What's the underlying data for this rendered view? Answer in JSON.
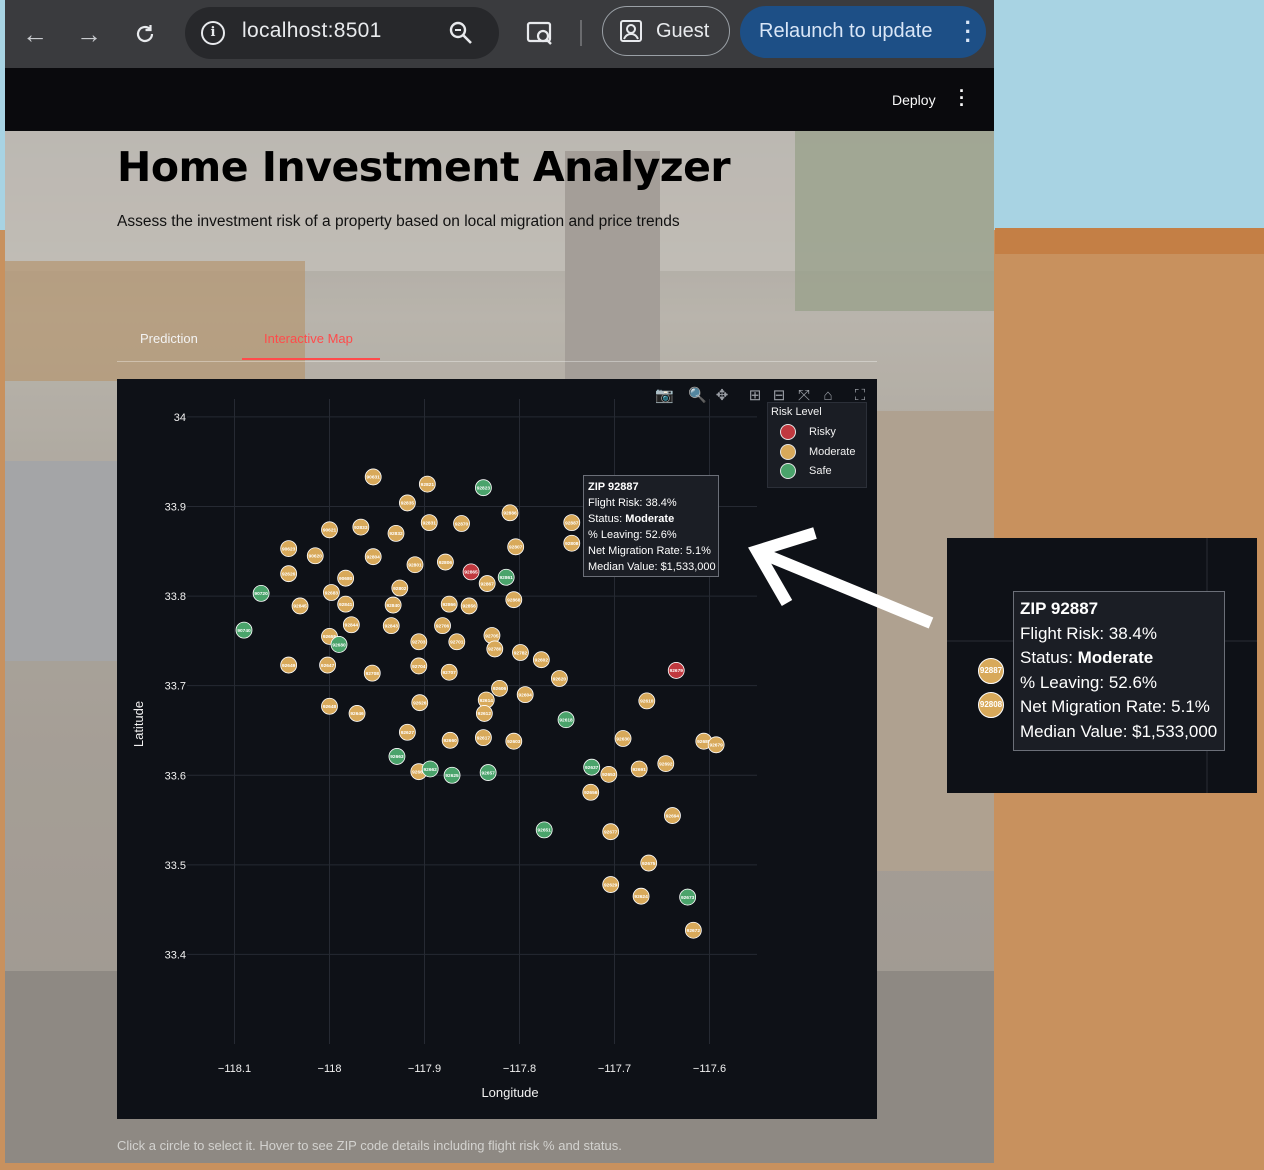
{
  "browser": {
    "url": "localhost:8501",
    "profile_label": "Guest",
    "relaunch_label": "Relaunch to update"
  },
  "header": {
    "deploy_label": "Deploy"
  },
  "page": {
    "title": "Home Investment Analyzer",
    "subtitle": "Assess the investment risk of a property based on local migration and price trends",
    "tabs": [
      {
        "label": "Prediction",
        "active": false
      },
      {
        "label": "Interactive Map",
        "active": true
      }
    ],
    "caption": "Click a circle to select it. Hover to see ZIP code details including flight risk % and status."
  },
  "colors": {
    "risky": "#c0393f",
    "moderate": "#d8a95a",
    "safe": "#4aa36b",
    "accent": "#ff4b4b",
    "plot_bg": "#0e1117"
  },
  "chart_data": {
    "type": "scatter",
    "xlabel": "Longitude",
    "ylabel": "Latitude",
    "xlim": [
      -118.15,
      -117.55
    ],
    "ylim": [
      33.3,
      34.02
    ],
    "xticks": [
      -118.1,
      -118,
      -117.9,
      -117.8,
      -117.7,
      -117.6
    ],
    "xtick_labels": [
      "−118.1",
      "−118",
      "−117.9",
      "−117.8",
      "−117.7",
      "−117.6"
    ],
    "yticks": [
      33.4,
      33.5,
      33.6,
      33.7,
      33.8,
      33.9,
      34
    ],
    "ytick_labels": [
      "33.4",
      "33.5",
      "33.6",
      "33.7",
      "33.8",
      "33.9",
      "34"
    ],
    "grid": true,
    "legend": {
      "title": "Risk Level",
      "placement": "top-right",
      "items": [
        "Risky",
        "Moderate",
        "Safe"
      ]
    },
    "points": [
      {
        "zip": "90631",
        "x": -117.954,
        "y": 33.933,
        "risk": "Moderate"
      },
      {
        "zip": "92821",
        "x": -117.897,
        "y": 33.925,
        "risk": "Moderate"
      },
      {
        "zip": "92823",
        "x": -117.838,
        "y": 33.921,
        "risk": "Safe"
      },
      {
        "zip": "92835",
        "x": -117.918,
        "y": 33.904,
        "risk": "Moderate"
      },
      {
        "zip": "92886",
        "x": -117.81,
        "y": 33.893,
        "risk": "Moderate"
      },
      {
        "zip": "92887",
        "x": -117.745,
        "y": 33.882,
        "risk": "Moderate"
      },
      {
        "zip": "92831",
        "x": -117.895,
        "y": 33.882,
        "risk": "Moderate"
      },
      {
        "zip": "92870",
        "x": -117.861,
        "y": 33.881,
        "risk": "Moderate"
      },
      {
        "zip": "90621",
        "x": -118.0,
        "y": 33.874,
        "risk": "Moderate"
      },
      {
        "zip": "92833",
        "x": -117.967,
        "y": 33.877,
        "risk": "Moderate"
      },
      {
        "zip": "92832",
        "x": -117.93,
        "y": 33.87,
        "risk": "Moderate"
      },
      {
        "zip": "92808",
        "x": -117.745,
        "y": 33.859,
        "risk": "Moderate"
      },
      {
        "zip": "92807",
        "x": -117.804,
        "y": 33.855,
        "risk": "Moderate"
      },
      {
        "zip": "90623",
        "x": -118.043,
        "y": 33.853,
        "risk": "Moderate"
      },
      {
        "zip": "90620",
        "x": -118.015,
        "y": 33.845,
        "risk": "Moderate"
      },
      {
        "zip": "92804",
        "x": -117.954,
        "y": 33.844,
        "risk": "Moderate"
      },
      {
        "zip": "92806",
        "x": -117.878,
        "y": 33.838,
        "risk": "Moderate"
      },
      {
        "zip": "92801",
        "x": -117.91,
        "y": 33.835,
        "risk": "Moderate"
      },
      {
        "zip": "92865",
        "x": -117.851,
        "y": 33.827,
        "risk": "Risky"
      },
      {
        "zip": "92626",
        "x": -118.043,
        "y": 33.825,
        "risk": "Moderate"
      },
      {
        "zip": "90680",
        "x": -117.983,
        "y": 33.82,
        "risk": "Moderate"
      },
      {
        "zip": "92861",
        "x": -117.814,
        "y": 33.821,
        "risk": "Safe"
      },
      {
        "zip": "92867",
        "x": -117.834,
        "y": 33.814,
        "risk": "Moderate"
      },
      {
        "zip": "92802",
        "x": -117.926,
        "y": 33.809,
        "risk": "Moderate"
      },
      {
        "zip": "90720",
        "x": -118.072,
        "y": 33.803,
        "risk": "Safe"
      },
      {
        "zip": "92683",
        "x": -117.998,
        "y": 33.804,
        "risk": "Moderate"
      },
      {
        "zip": "92868",
        "x": -117.806,
        "y": 33.796,
        "risk": "Moderate"
      },
      {
        "zip": "92845",
        "x": -118.031,
        "y": 33.789,
        "risk": "Moderate"
      },
      {
        "zip": "92841",
        "x": -117.983,
        "y": 33.791,
        "risk": "Moderate"
      },
      {
        "zip": "92840",
        "x": -117.933,
        "y": 33.79,
        "risk": "Moderate"
      },
      {
        "zip": "92866",
        "x": -117.874,
        "y": 33.791,
        "risk": "Moderate"
      },
      {
        "zip": "92856",
        "x": -117.853,
        "y": 33.789,
        "risk": "Moderate"
      },
      {
        "zip": "90740",
        "x": -118.09,
        "y": 33.762,
        "risk": "Safe"
      },
      {
        "zip": "92844",
        "x": -117.977,
        "y": 33.768,
        "risk": "Moderate"
      },
      {
        "zip": "92843",
        "x": -117.935,
        "y": 33.767,
        "risk": "Moderate"
      },
      {
        "zip": "92706",
        "x": -117.881,
        "y": 33.767,
        "risk": "Moderate"
      },
      {
        "zip": "92655",
        "x": -118.0,
        "y": 33.755,
        "risk": "Moderate"
      },
      {
        "zip": "92705",
        "x": -117.829,
        "y": 33.756,
        "risk": "Moderate"
      },
      {
        "zip": "92703",
        "x": -117.906,
        "y": 33.749,
        "risk": "Moderate"
      },
      {
        "zip": "92701",
        "x": -117.866,
        "y": 33.749,
        "risk": "Moderate"
      },
      {
        "zip": "92680",
        "x": -117.99,
        "y": 33.746,
        "risk": "Safe"
      },
      {
        "zip": "92780",
        "x": -117.826,
        "y": 33.741,
        "risk": "Moderate"
      },
      {
        "zip": "92782",
        "x": -117.799,
        "y": 33.737,
        "risk": "Moderate"
      },
      {
        "zip": "92602",
        "x": -117.777,
        "y": 33.729,
        "risk": "Moderate"
      },
      {
        "zip": "92649",
        "x": -118.043,
        "y": 33.723,
        "risk": "Moderate"
      },
      {
        "zip": "92647",
        "x": -118.002,
        "y": 33.723,
        "risk": "Moderate"
      },
      {
        "zip": "92704",
        "x": -117.906,
        "y": 33.722,
        "risk": "Moderate"
      },
      {
        "zip": "92679",
        "x": -117.635,
        "y": 33.717,
        "risk": "Risky"
      },
      {
        "zip": "92708",
        "x": -117.955,
        "y": 33.714,
        "risk": "Moderate"
      },
      {
        "zip": "92707",
        "x": -117.874,
        "y": 33.715,
        "risk": "Moderate"
      },
      {
        "zip": "92620",
        "x": -117.758,
        "y": 33.708,
        "risk": "Moderate"
      },
      {
        "zip": "92606",
        "x": -117.821,
        "y": 33.697,
        "risk": "Moderate"
      },
      {
        "zip": "92604",
        "x": -117.794,
        "y": 33.69,
        "risk": "Moderate"
      },
      {
        "zip": "92614",
        "x": -117.835,
        "y": 33.684,
        "risk": "Moderate"
      },
      {
        "zip": "92610",
        "x": -117.666,
        "y": 33.683,
        "risk": "Moderate"
      },
      {
        "zip": "92626",
        "x": -117.905,
        "y": 33.681,
        "risk": "Moderate"
      },
      {
        "zip": "92648",
        "x": -118.0,
        "y": 33.677,
        "risk": "Moderate"
      },
      {
        "zip": "92646",
        "x": -117.971,
        "y": 33.669,
        "risk": "Moderate"
      },
      {
        "zip": "92612",
        "x": -117.837,
        "y": 33.669,
        "risk": "Moderate"
      },
      {
        "zip": "92618",
        "x": -117.751,
        "y": 33.662,
        "risk": "Safe"
      },
      {
        "zip": "92627",
        "x": -117.918,
        "y": 33.648,
        "risk": "Moderate"
      },
      {
        "zip": "92617",
        "x": -117.838,
        "y": 33.642,
        "risk": "Moderate"
      },
      {
        "zip": "92630",
        "x": -117.691,
        "y": 33.641,
        "risk": "Moderate"
      },
      {
        "zip": "92660",
        "x": -117.873,
        "y": 33.639,
        "risk": "Moderate"
      },
      {
        "zip": "92603",
        "x": -117.806,
        "y": 33.638,
        "risk": "Moderate"
      },
      {
        "zip": "92688",
        "x": -117.606,
        "y": 33.638,
        "risk": "Moderate"
      },
      {
        "zip": "92679",
        "x": -117.593,
        "y": 33.634,
        "risk": "Moderate"
      },
      {
        "zip": "92663",
        "x": -117.929,
        "y": 33.621,
        "risk": "Safe"
      },
      {
        "zip": "92637",
        "x": -117.724,
        "y": 33.609,
        "risk": "Safe"
      },
      {
        "zip": "92661",
        "x": -117.906,
        "y": 33.604,
        "risk": "Moderate"
      },
      {
        "zip": "92662",
        "x": -117.894,
        "y": 33.607,
        "risk": "Safe"
      },
      {
        "zip": "92625",
        "x": -117.871,
        "y": 33.6,
        "risk": "Safe"
      },
      {
        "zip": "92657",
        "x": -117.833,
        "y": 33.603,
        "risk": "Safe"
      },
      {
        "zip": "92653",
        "x": -117.706,
        "y": 33.601,
        "risk": "Moderate"
      },
      {
        "zip": "92691",
        "x": -117.674,
        "y": 33.607,
        "risk": "Moderate"
      },
      {
        "zip": "92692",
        "x": -117.646,
        "y": 33.613,
        "risk": "Moderate"
      },
      {
        "zip": "92656",
        "x": -117.725,
        "y": 33.581,
        "risk": "Moderate"
      },
      {
        "zip": "92694",
        "x": -117.639,
        "y": 33.555,
        "risk": "Moderate"
      },
      {
        "zip": "92651",
        "x": -117.774,
        "y": 33.539,
        "risk": "Safe"
      },
      {
        "zip": "92677",
        "x": -117.704,
        "y": 33.537,
        "risk": "Moderate"
      },
      {
        "zip": "92675",
        "x": -117.664,
        "y": 33.502,
        "risk": "Moderate"
      },
      {
        "zip": "92629",
        "x": -117.704,
        "y": 33.478,
        "risk": "Moderate"
      },
      {
        "zip": "92624",
        "x": -117.672,
        "y": 33.465,
        "risk": "Moderate"
      },
      {
        "zip": "92673",
        "x": -117.623,
        "y": 33.464,
        "risk": "Safe"
      },
      {
        "zip": "92672",
        "x": -117.617,
        "y": 33.427,
        "risk": "Moderate"
      }
    ]
  },
  "tooltip": {
    "zip_line": "ZIP 92887",
    "flight_risk": "Flight Risk: 38.4%",
    "status_prefix": "Status: ",
    "status_value": "Moderate",
    "leaving": "% Leaving: 52.6%",
    "net_migration": "Net Migration Rate: 5.1%",
    "median_value": "Median Value: $1,533,000"
  },
  "inset": {
    "dot_a": "92887",
    "dot_b": "92808"
  }
}
